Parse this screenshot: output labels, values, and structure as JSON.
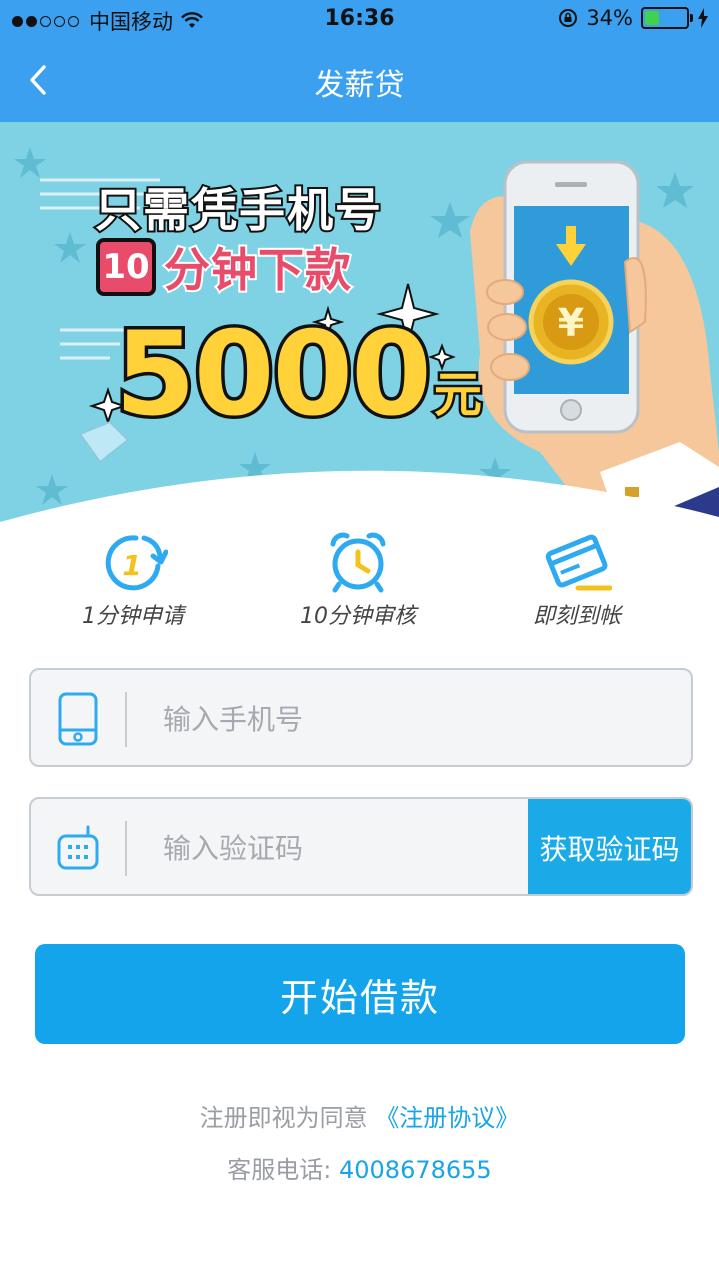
{
  "status_bar": {
    "carrier": "中国移动",
    "time": "16:36",
    "battery": "34%",
    "battery_level": 0.34
  },
  "nav": {
    "title": "发薪贷"
  },
  "banner": {
    "line1": "只需凭手机号",
    "badge": "10",
    "line2": "分钟下款",
    "amount": "5000",
    "unit": "元"
  },
  "features": [
    {
      "label": "1分钟申请",
      "icon": "clock-1-icon"
    },
    {
      "label": "10分钟审核",
      "icon": "alarm-clock-icon"
    },
    {
      "label": "即刻到帐",
      "icon": "credit-card-icon"
    }
  ],
  "form": {
    "phone_placeholder": "输入手机号",
    "code_placeholder": "输入验证码",
    "get_code_label": "获取验证码",
    "submit_label": "开始借款"
  },
  "footer": {
    "agreement_prefix": "注册即视为同意",
    "agreement_link": "《注册协议》",
    "service_prefix": "客服电话: ",
    "service_phone": "4008678655"
  },
  "colors": {
    "header": "#3aa0ef",
    "accent": "#14a4ec",
    "banner_bg": "#7fd2e4",
    "amount": "#ffd23a",
    "badge": "#e94b6a"
  }
}
